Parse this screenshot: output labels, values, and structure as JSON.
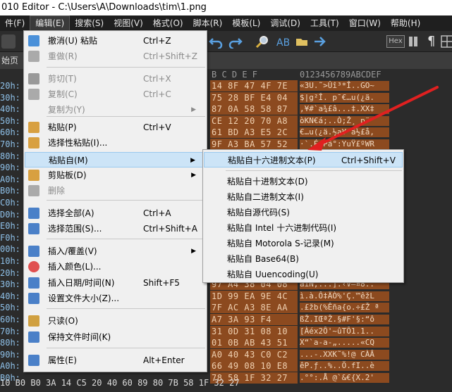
{
  "window": {
    "title": "010 Editor - C:\\Users\\A\\Downloads\\tim\\1.png"
  },
  "menubar": [
    "件(F)",
    "编辑(E)",
    "搜索(S)",
    "视图(V)",
    "格式(O)",
    "脚本(R)",
    "模板(L)",
    "调试(D)",
    "工具(T)",
    "窗口(W)",
    "帮助(H)"
  ],
  "tab": {
    "label": "始页"
  },
  "toolbar": {
    "hex_button": "Hex"
  },
  "editor": {
    "column_header_hex": "B  C  D  E  F",
    "column_header_ascii": "0123456789ABCDEF",
    "addresses": [
      "20h:",
      "30h:",
      "40h:",
      "50h:",
      "60h:",
      "70h:",
      "80h:",
      "90h:",
      "A0h:",
      "B0h:",
      "C0h:",
      "D0h:",
      "E0h:",
      "F0h:",
      "00h:",
      "10h:",
      "20h:",
      "30h:",
      "40h:",
      "50h:",
      "60h:",
      "70h:",
      "80h:",
      "90h:",
      "A0h:",
      "B0h:"
    ],
    "hex_rows": [
      "14 8F 47 4F 7E",
      "75 28 BF E4 04",
      "87 0A 58 58 87",
      "CE 12 20 70 A8",
      "61 BD A3 E5 2C",
      "9F A3 BA 57 52",
      "",
      "",
      "",
      "",
      "",
      "",
      "",
      "",
      "",
      "",
      "40 08 EC 2E 60",
      "97 A4 38 04 08",
      "1D 99 EA 9E 4C",
      "7F AC A3 8E AA",
      "A7 3A 93 F4",
      "31 0D 31 08 10",
      "01 0B AB 43 51",
      "A0 40 43 C0 C2",
      "66 49 08 10 E8",
      "78 58 1F 32 27"
    ],
    "ascii_rows": [
      "«3U.˜>Ûî³*Î..GO~",
      "$|g²Î. p¯€…u(¿ä.",
      "‚¥#`a¾£â...‡.XX‡",
      "òKN€á;..Ò;Ž¸ p¨",
      "€…u(¿ä.½a¥ ä½£å,",
      "·`.É.Pâ°:YuŸ£ºWR",
      "",
      "",
      "",
      "",
      "",
      "",
      "",
      "",
      "",
      "",
      "‚...].‹V—¤8..ì.`",
      "aîN,...].‹V—¤8..",
      "ì.à.Ô‡ÄÒ%'Ç.™êžL",
      ".£žb(%Êña{o.÷£Ž ª",
      "ßŽ.IŒªŽ.§#F'§:“ô",
      "[Àéx2Ô'~ûTÔ1.1..",
      "X“`a-a-„.....«CQ",
      "...-.XXK˜%!@ CÀÂ",
      "êP.ƒ..%..Ö.fI..è",
      ".°°:.Å @`&€{X.2'"
    ],
    "left_hex_rows": [
      "10 B0 B0 3A 14 C5 20 40 60 89 80 7B 58 1F 32 27"
    ]
  },
  "edit_menu": {
    "items": [
      {
        "icon": "undo-icon",
        "label": "撤消(U) 粘贴",
        "shortcut": "Ctrl+Z",
        "disabled": false
      },
      {
        "icon": "redo-icon",
        "label": "重做(R)",
        "shortcut": "Ctrl+Shift+Z",
        "disabled": true
      },
      {
        "icon": "cut-icon",
        "label": "剪切(T)",
        "shortcut": "Ctrl+X",
        "disabled": true
      },
      {
        "icon": "copy-icon",
        "label": "复制(C)",
        "shortcut": "Ctrl+C",
        "disabled": true
      },
      {
        "icon": "",
        "label": "复制为(Y)",
        "shortcut": "",
        "disabled": true
      },
      {
        "icon": "paste-icon",
        "label": "粘贴(P)",
        "shortcut": "Ctrl+V",
        "disabled": false
      },
      {
        "icon": "paste-special-icon",
        "label": "选择性粘贴(I)...",
        "shortcut": "",
        "disabled": false
      },
      {
        "icon": "",
        "label": "粘贴自(M)",
        "shortcut": "",
        "disabled": false
      },
      {
        "icon": "clipboard-icon",
        "label": "剪贴板(D)",
        "shortcut": "",
        "disabled": false
      },
      {
        "icon": "delete-icon",
        "label": "删除",
        "shortcut": "",
        "disabled": true
      },
      {
        "icon": "select-all-icon",
        "label": "选择全部(A)",
        "shortcut": "Ctrl+A",
        "disabled": false
      },
      {
        "icon": "select-range-icon",
        "label": "选择范围(S)...",
        "shortcut": "Ctrl+Shift+A",
        "disabled": false
      },
      {
        "icon": "insert-overwrite-icon",
        "label": "插入/覆盖(V)",
        "shortcut": "",
        "disabled": false
      },
      {
        "icon": "insert-color-icon",
        "label": "插入颜色(L)...",
        "shortcut": "",
        "disabled": false
      },
      {
        "icon": "insert-date-icon",
        "label": "插入日期/时间(N)",
        "shortcut": "Shift+F5",
        "disabled": false
      },
      {
        "icon": "file-size-icon",
        "label": "设置文件大小(Z)...",
        "shortcut": "",
        "disabled": false
      },
      {
        "icon": "readonly-icon",
        "label": "只读(O)",
        "shortcut": "",
        "disabled": false
      },
      {
        "icon": "keep-time-icon",
        "label": "保持文件时间(K)",
        "shortcut": "",
        "disabled": false
      },
      {
        "icon": "properties-icon",
        "label": "属性(E)",
        "shortcut": "Alt+Enter",
        "disabled": false
      }
    ]
  },
  "paste_from_submenu": {
    "items": [
      {
        "label": "粘贴自十六进制文本(P)",
        "shortcut": "Ctrl+Shift+V"
      },
      {
        "label": "粘贴自十进制文本(D)",
        "shortcut": ""
      },
      {
        "label": "粘贴自二进制文本(I)",
        "shortcut": ""
      },
      {
        "label": "粘贴自源代码(S)",
        "shortcut": ""
      },
      {
        "label": "粘贴自 Intel 十六进制代码(I)",
        "shortcut": ""
      },
      {
        "label": "粘贴自 Motorola S-记录(M)",
        "shortcut": ""
      },
      {
        "label": "粘贴自 Base64(B)",
        "shortcut": ""
      },
      {
        "label": "粘贴自 Uuencoding(U)",
        "shortcut": ""
      }
    ]
  },
  "colors": {
    "accent_arrow": "#e02020",
    "highlight": "#cce4f7",
    "hex_bg": "#8c4a1f"
  }
}
